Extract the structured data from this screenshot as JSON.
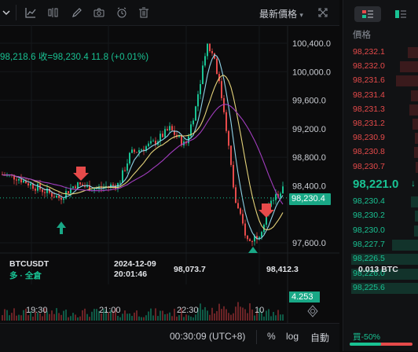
{
  "toolbar": {
    "collapse_icon": "chevron-down-icon",
    "icons": [
      "line-chart-icon",
      "indicator-icon",
      "draw-pen-icon",
      "camera-icon",
      "alarm-clock-icon",
      "trash-icon"
    ],
    "price_type_label": "最新價格",
    "expand_icon": "fullscreen-icon"
  },
  "legend": {
    "text": "98,218.6 收=98,230.4 11.8 (+0.01%)"
  },
  "price_axis": [
    "100,400.0",
    "100,000.0",
    "99,600.0",
    "99,200.0",
    "98,800.0",
    "98,400.0",
    "97,600.0"
  ],
  "current_price_tag": "98,230.4",
  "volume_tag": "4.253",
  "time_axis": [
    "19:30",
    "21:00",
    "22:30",
    "10"
  ],
  "trade_info": {
    "symbol": "BTCUSDT",
    "side": "多 · 全倉",
    "date": "2024-12-09",
    "time": "20:01:46",
    "entry_price": "98,073.7",
    "mark_price": "98,412.3",
    "quantity": "0.013 BTC"
  },
  "bottom_bar": {
    "clock": "00:30:09 (UTC+8)",
    "percent_label": "%",
    "log_label": "log",
    "auto_label": "自動",
    "settings_icon": "gear-icon"
  },
  "order_book": {
    "header": "價格",
    "asks": [
      "98,232.1",
      "98,232.0",
      "98,231.6",
      "98,231.4",
      "98,231.3",
      "98,231.2",
      "98,230.9",
      "98,230.8",
      "98,230.7"
    ],
    "mid_price": "98,221.0",
    "mid_arrow": "↓",
    "bids": [
      "98,230.4",
      "98,230.2",
      "98,230.0",
      "98,227.7",
      "98,226.5",
      "98,226.0",
      "98,225.6"
    ],
    "ratio_label": "買-50%"
  },
  "colors": {
    "up": "#19c293",
    "down": "#e64a4a",
    "accent": "#19a886"
  }
}
